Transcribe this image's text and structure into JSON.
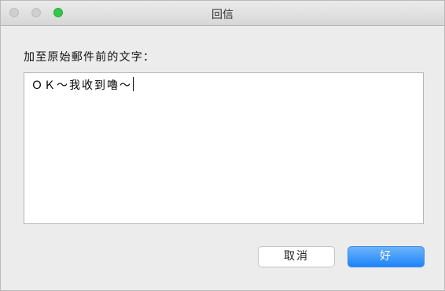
{
  "window": {
    "title": "回信"
  },
  "form": {
    "prompt_label": "加至原始郵件前的文字：",
    "text_value": "ＯＫ～我收到嚕～"
  },
  "buttons": {
    "cancel_label": "取消",
    "ok_label": "好"
  },
  "colors": {
    "zoom_button": "#34c84a",
    "primary_button": "#1d84f8"
  }
}
